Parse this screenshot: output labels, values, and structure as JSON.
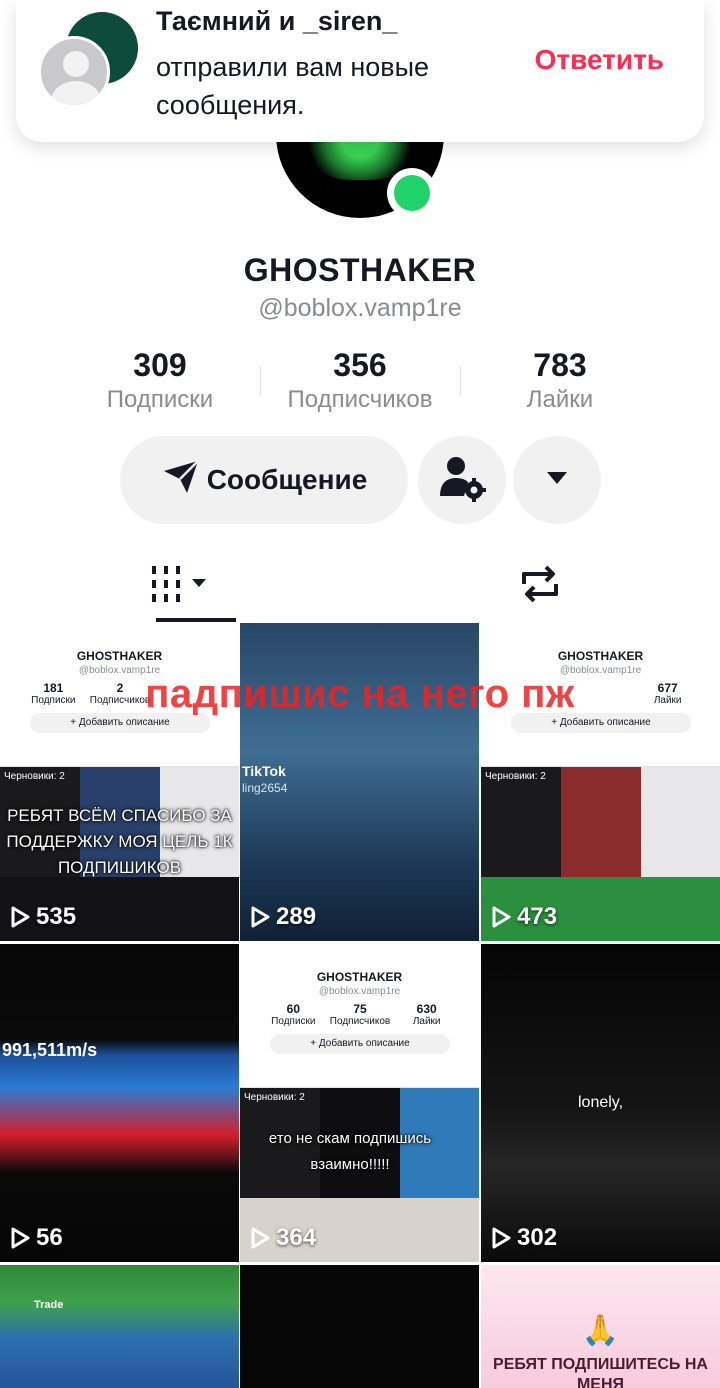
{
  "notification": {
    "title": "Таємний и _siren_",
    "body": "отправили вам новые сообщения.",
    "reply_label": "Ответить"
  },
  "profile": {
    "display_name": "GHOSTHAKER",
    "handle": "@boblox.vamp1re",
    "stats": [
      {
        "value": "309",
        "label": "Подписки"
      },
      {
        "value": "356",
        "label": "Подписчиков"
      },
      {
        "value": "783",
        "label": "Лайки"
      }
    ],
    "message_button": "Сообщение"
  },
  "colors": {
    "accent": "#fe2c55",
    "online": "#20d36b",
    "button_bg": "#f1f1f2",
    "muted_text": "#8a8b91"
  },
  "icons": {
    "send": "send-icon",
    "user_settings": "user-settings-icon",
    "dropdown": "caret-down-icon",
    "grid_tab": "video-grid-icon",
    "repost_tab": "repost-icon",
    "play": "play-icon"
  },
  "overlay_caption": "падпишис на него пж",
  "videos": [
    {
      "views": "535",
      "mini_name": "GHOSTHAKER",
      "mini_handle": "@boblox.vamp1re",
      "mini_stats": [
        {
          "v": "181",
          "l": "Подписки"
        },
        {
          "v": "2",
          "l": "Подписчиков"
        },
        {
          "v": "",
          "l": ""
        }
      ],
      "mini_button": "+ Добавить описание",
      "drafts": "Черновики: 2",
      "caption": "РЕБЯТ ВСЁМ СПАСИБО ЗА ПОДДЕРЖКУ МОЯ ЦЕЛЬ 1К ПОДПИШИКОВ"
    },
    {
      "views": "289",
      "watermark": "TikTok",
      "watermark_user": "ling2654"
    },
    {
      "views": "473",
      "mini_name": "GHOSTHAKER",
      "mini_handle": "@boblox.vamp1re",
      "mini_stats": [
        {
          "v": "",
          "l": ""
        },
        {
          "v": "",
          "l": ""
        },
        {
          "v": "677",
          "l": "Лайки"
        }
      ],
      "mini_button": "+ Добавить описание",
      "drafts": "Черновики: 2"
    },
    {
      "views": "56",
      "speed": "991,511m/s"
    },
    {
      "views": "364",
      "mini_name": "GHOSTHAKER",
      "mini_handle": "@boblox.vamp1re",
      "mini_stats": [
        {
          "v": "60",
          "l": "Подписки"
        },
        {
          "v": "75",
          "l": "Подписчиков"
        },
        {
          "v": "630",
          "l": "Лайки"
        }
      ],
      "mini_button": "+ Добавить описание",
      "drafts": "Черновики: 2",
      "caption": "ето не скам подпишись взаимно!!!!!"
    },
    {
      "views": "302",
      "caption": "lonely,"
    },
    {
      "views": "",
      "caption": "Trade"
    },
    {
      "views": ""
    },
    {
      "views": "",
      "caption": "РЕБЯТ ПОДПИШИТЕСЬ НА МЕНЯ"
    }
  ]
}
